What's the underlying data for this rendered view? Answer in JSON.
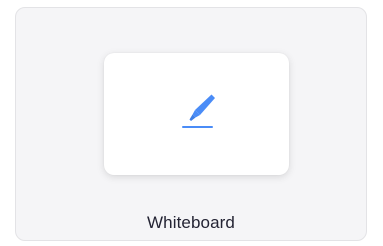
{
  "option": {
    "label": "Whiteboard",
    "icon": "highlighter-icon",
    "accent_color": "#4a8cf7"
  }
}
